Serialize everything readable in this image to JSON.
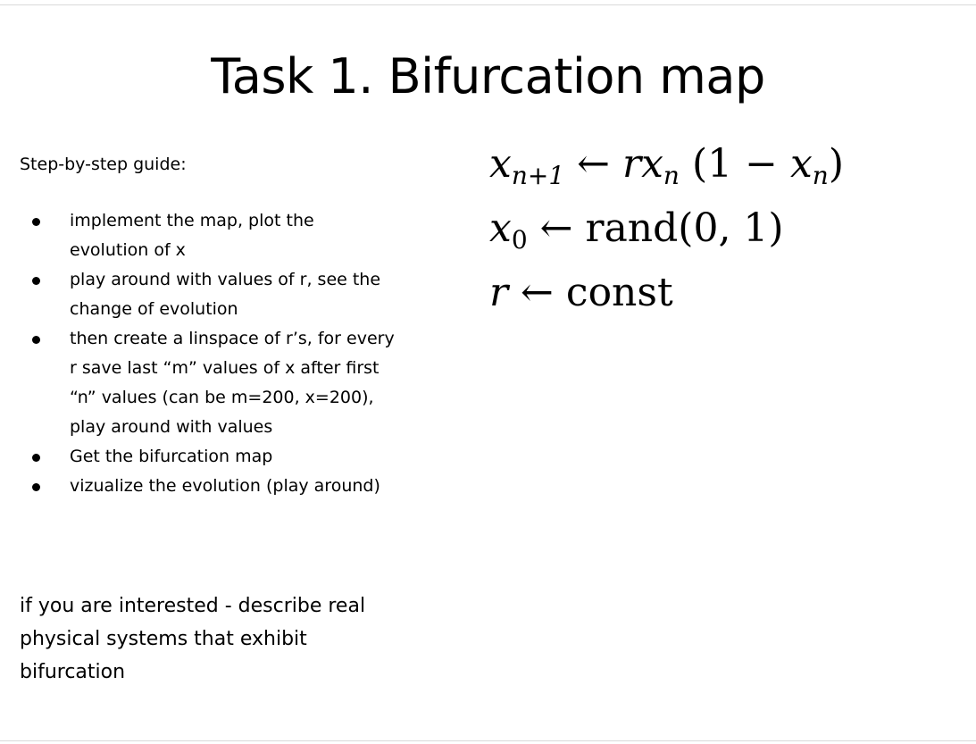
{
  "title": "Task 1. Bifurcation map",
  "guide": {
    "heading": "Step-by-step guide:",
    "steps": [
      [
        "implement the map, plot the",
        "evolution of x"
      ],
      [
        "play around with values of r, see the",
        "change of evolution"
      ],
      [
        "then create a linspace of r’s, for every",
        "r save last “m” values of x after first",
        "“n” values (can be m=200, x=200),",
        "play around with values"
      ],
      [
        "Get the bifurcation map"
      ],
      [
        "vizualize the evolution (play around)"
      ]
    ]
  },
  "note": [
    "if you are interested - describe real",
    "physical systems that exhibit",
    "bifurcation"
  ],
  "formulas": {
    "eq1": {
      "lhs_var": "x",
      "lhs_sub": "n+1",
      "arrow": "←",
      "r": "r",
      "x": "x",
      "sub": "n",
      "open": "(1 −",
      "x2": "x",
      "sub2": "n",
      "close": ")"
    },
    "eq2": {
      "var": "x",
      "sub": "0",
      "arrow": "←",
      "rhs": "rand(0, 1)"
    },
    "eq3": {
      "var": "r",
      "arrow": "←",
      "rhs": "const"
    }
  }
}
